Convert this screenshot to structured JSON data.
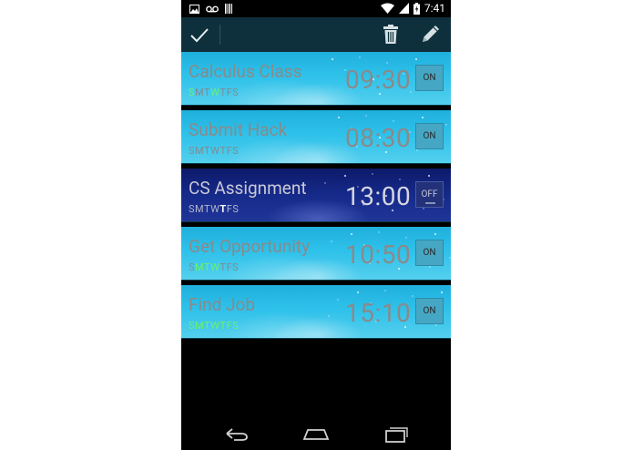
{
  "status_bar": {
    "time": "7:41",
    "left_icons": [
      "image-icon",
      "voicemail-icon",
      "barcode-icon"
    ],
    "right_icons": [
      "wifi-icon",
      "signal-icon",
      "battery-icon"
    ]
  },
  "action_bar": {
    "confirm_icon": "check-icon",
    "delete_icon": "trash-icon",
    "edit_icon": "pencil-icon"
  },
  "alarms": [
    {
      "name": "Calculus Class",
      "time": "09:30",
      "toggle": "ON",
      "enabled": true,
      "days": [
        {
          "l": "S",
          "on": true
        },
        {
          "l": "M",
          "on": false
        },
        {
          "l": "T",
          "on": false
        },
        {
          "l": "W",
          "on": true
        },
        {
          "l": "T",
          "on": false
        },
        {
          "l": "F",
          "on": false
        },
        {
          "l": "S",
          "on": false
        }
      ]
    },
    {
      "name": "Submit Hack",
      "time": "08:30",
      "toggle": "ON",
      "enabled": true,
      "days": [
        {
          "l": "S",
          "on": false
        },
        {
          "l": "M",
          "on": false
        },
        {
          "l": "T",
          "on": false
        },
        {
          "l": "W",
          "on": false
        },
        {
          "l": "T",
          "on": false
        },
        {
          "l": "F",
          "on": false
        },
        {
          "l": "S",
          "on": false
        }
      ]
    },
    {
      "name": "CS Assignment",
      "time": "13:00",
      "toggle": "OFF",
      "enabled": false,
      "days": [
        {
          "l": "S",
          "on": false
        },
        {
          "l": "M",
          "on": false
        },
        {
          "l": "T",
          "on": false
        },
        {
          "l": "W",
          "on": false
        },
        {
          "l": "T",
          "on": true
        },
        {
          "l": "F",
          "on": false
        },
        {
          "l": "S",
          "on": false
        }
      ]
    },
    {
      "name": "Get Opportunity",
      "time": "10:50",
      "toggle": "ON",
      "enabled": true,
      "days": [
        {
          "l": "S",
          "on": false
        },
        {
          "l": "M",
          "on": true
        },
        {
          "l": "T",
          "on": true
        },
        {
          "l": "W",
          "on": true
        },
        {
          "l": "T",
          "on": false
        },
        {
          "l": "F",
          "on": false
        },
        {
          "l": "S",
          "on": false
        }
      ]
    },
    {
      "name": "Find Job",
      "time": "15:10",
      "toggle": "ON",
      "enabled": true,
      "days": [
        {
          "l": "S",
          "on": true
        },
        {
          "l": "M",
          "on": true
        },
        {
          "l": "T",
          "on": true
        },
        {
          "l": "W",
          "on": true
        },
        {
          "l": "T",
          "on": true
        },
        {
          "l": "F",
          "on": true
        },
        {
          "l": "S",
          "on": true
        }
      ]
    }
  ],
  "nav_bar": {
    "back_icon": "back-icon",
    "home_icon": "home-icon",
    "recents_icon": "recents-icon"
  },
  "colors": {
    "action_bar": "#0e2f3c",
    "active_day": "#6af26a",
    "card_on": "#2ec1ea",
    "card_off": "#162a8a"
  }
}
